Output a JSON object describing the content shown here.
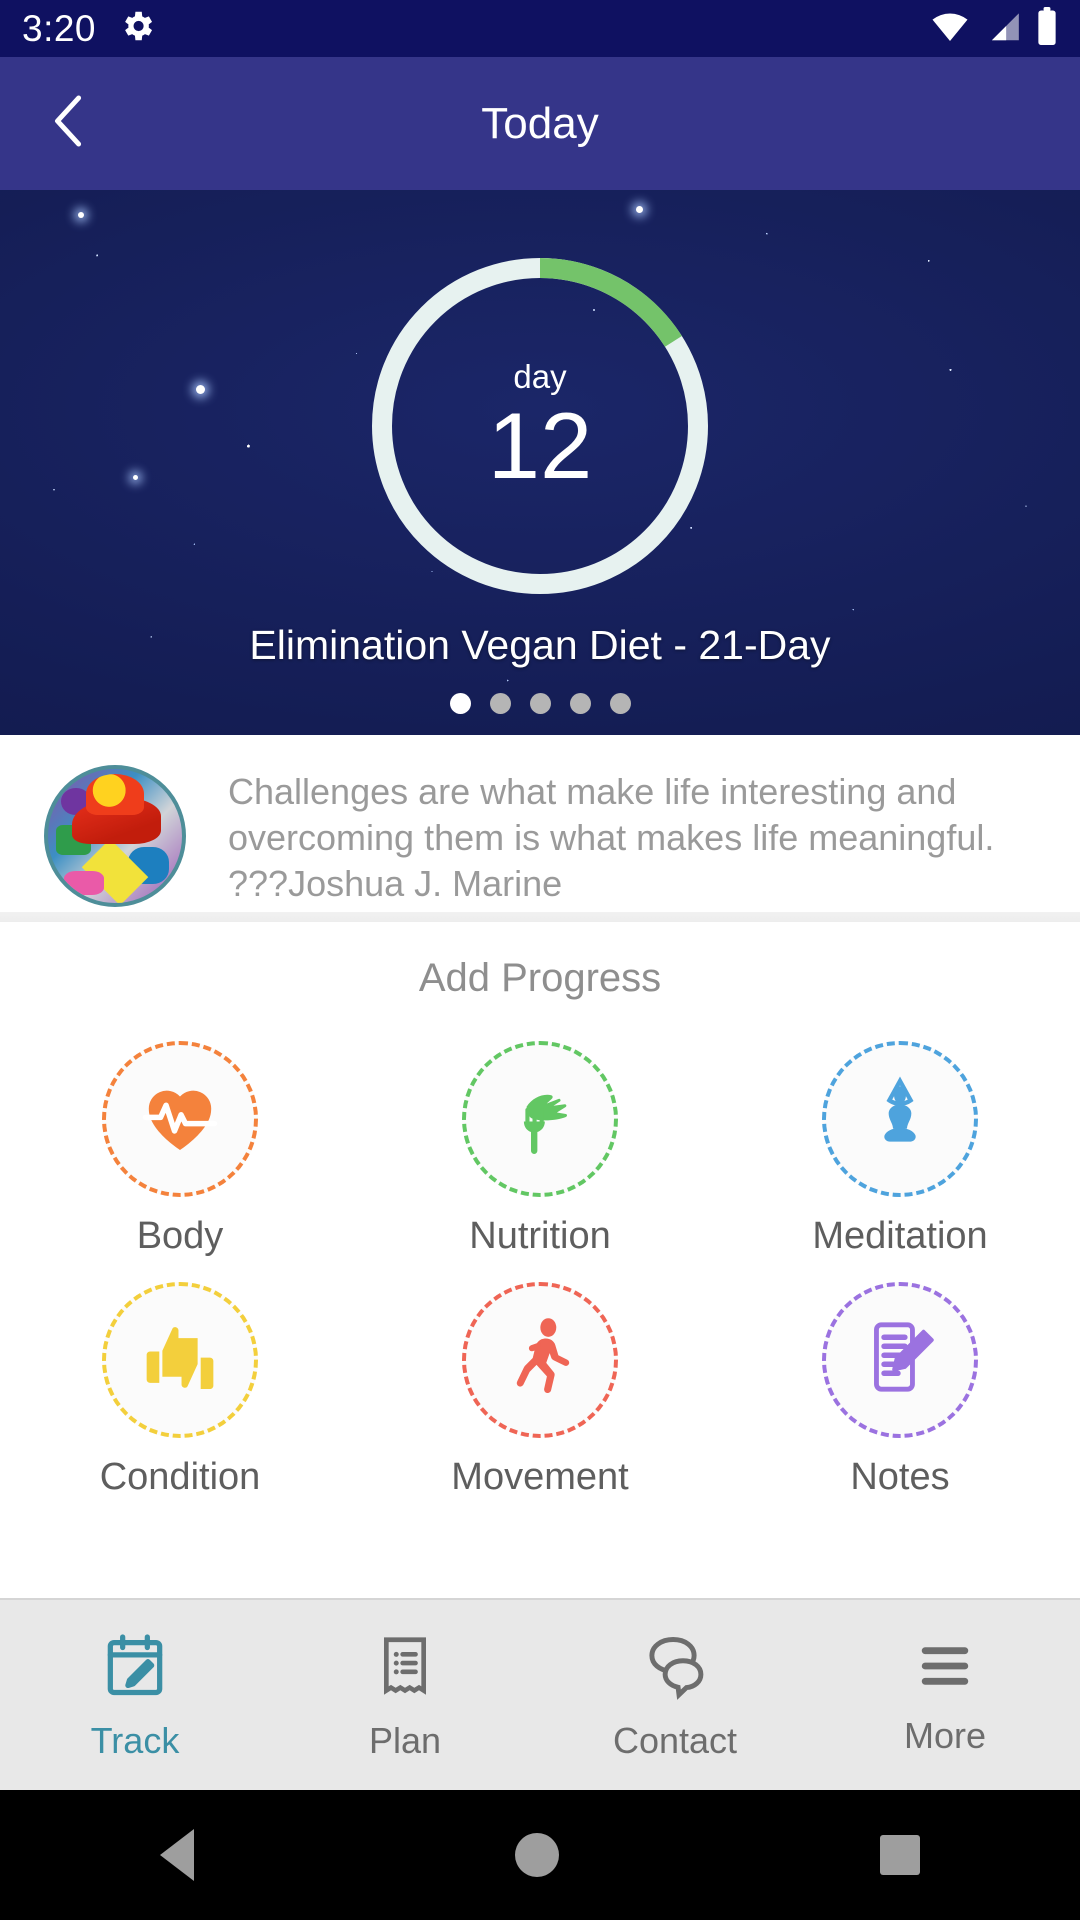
{
  "statusbar": {
    "time": "3:20",
    "icons": [
      "gear-icon",
      "wifi-icon",
      "cell-signal-icon",
      "battery-icon"
    ]
  },
  "appbar": {
    "title": "Today",
    "back_icon": "chevron-left-icon"
  },
  "hero": {
    "ring_label": "day",
    "ring_value": "12",
    "progress_percent": 16,
    "total_days": 21,
    "plan_title": "Elimination Vegan Diet  - 21-Day",
    "dots_total": 5,
    "dots_active_index": 0,
    "ring_track_color": "#e7f2f0",
    "ring_fill_color": "#74c36a"
  },
  "quote": {
    "text": "Challenges are what make life interesting and overcoming them is what makes life meaningful. ???Joshua J. Marine",
    "avatar_name": "quote-author-avatar"
  },
  "progress": {
    "section_title": "Add Progress",
    "items": [
      {
        "label": "Body",
        "icon": "heart-pulse-icon",
        "color": "#f4823c"
      },
      {
        "label": "Nutrition",
        "icon": "fork-vegetable-icon",
        "color": "#62c763"
      },
      {
        "label": "Meditation",
        "icon": "yoga-pose-icon",
        "color": "#4ea3dd"
      },
      {
        "label": "Condition",
        "icon": "thumbs-up-down-icon",
        "color": "#f3cf3c"
      },
      {
        "label": "Movement",
        "icon": "running-person-icon",
        "color": "#ef6555"
      },
      {
        "label": "Notes",
        "icon": "notepad-pencil-icon",
        "color": "#9b72e0"
      }
    ]
  },
  "tabbar": {
    "active_color": "#3b8fa5",
    "items": [
      {
        "label": "Track",
        "icon": "calendar-pencil-icon",
        "active": true
      },
      {
        "label": "Plan",
        "icon": "receipt-list-icon",
        "active": false
      },
      {
        "label": "Contact",
        "icon": "speech-bubbles-icon",
        "active": false
      },
      {
        "label": "More",
        "icon": "hamburger-menu-icon",
        "active": false
      }
    ]
  },
  "androidnav": {
    "back": "back-triangle-icon",
    "home": "home-circle-icon",
    "recents": "recents-square-icon"
  }
}
